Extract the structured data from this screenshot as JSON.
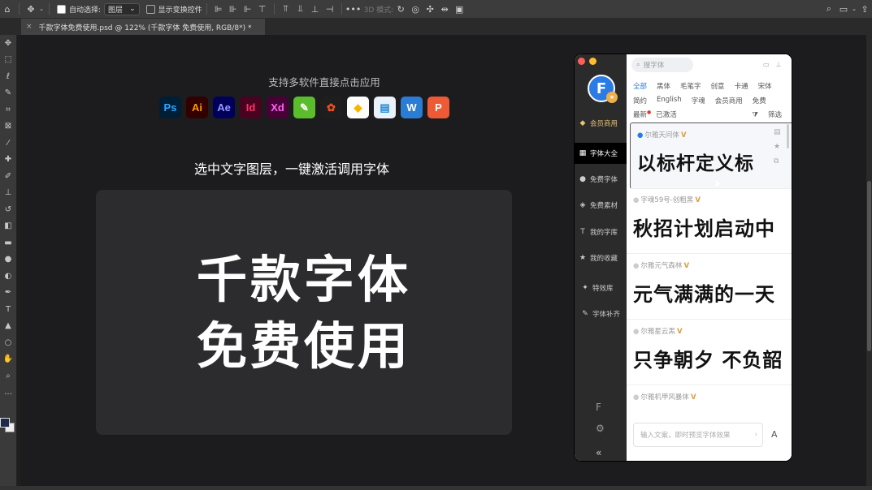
{
  "optbar": {
    "auto_select_label": "自动选择:",
    "auto_select_value": "图层",
    "show_transform_label": "显示变换控件",
    "mode_3d_label": "3D 模式:"
  },
  "tab": {
    "close": "×",
    "title": "千款字体免费使用.psd @ 122% (千款字体 免费使用, RGB/8*) *"
  },
  "canvas": {
    "subtitle": "支持多软件直接点击应用",
    "apps": [
      {
        "label": "Ps",
        "bg": "#001e36",
        "fg": "#31a8ff"
      },
      {
        "label": "Ai",
        "bg": "#330000",
        "fg": "#ff9a00"
      },
      {
        "label": "Ae",
        "bg": "#00005b",
        "fg": "#9999ff"
      },
      {
        "label": "Id",
        "bg": "#49021f",
        "fg": "#ff3366"
      },
      {
        "label": "Xd",
        "bg": "#470137",
        "fg": "#ff61f6"
      },
      {
        "label": "",
        "bg": "#5bbd2b",
        "fg": "#ffffff"
      },
      {
        "label": "",
        "bg": "#1e1e1e",
        "fg": "#f24e1e"
      },
      {
        "label": "",
        "bg": "#fdfdfd",
        "fg": "#f7b500"
      },
      {
        "label": "",
        "bg": "#e9f2fb",
        "fg": "#1f8bd6"
      },
      {
        "label": "W",
        "bg": "#2b7cd3",
        "fg": "#ffffff"
      },
      {
        "label": "P",
        "bg": "#ee5a35",
        "fg": "#ffffff"
      }
    ],
    "headline": "选中文字图层，一键激活调用字体",
    "big_line1": "千款字体",
    "big_line2": "免费使用"
  },
  "panel": {
    "nav": [
      {
        "label": "会员商用",
        "icon": "◆"
      },
      {
        "label": "字体大全",
        "icon": "▦"
      },
      {
        "label": "免费字体",
        "icon": "●"
      },
      {
        "label": "免费素材",
        "icon": "◈"
      },
      {
        "label": "我的字库",
        "icon": "T"
      },
      {
        "label": "我的收藏",
        "icon": "★"
      },
      {
        "label": "特效库",
        "icon": "✦"
      },
      {
        "label": "字体补齐",
        "icon": "✎"
      }
    ],
    "collapse": "«",
    "search_placeholder": "搜字体",
    "cats_row1": [
      "全部",
      "黑体",
      "毛笔字",
      "创意",
      "卡通",
      "宋体"
    ],
    "cats_row2": [
      "简约",
      "English",
      "字魂",
      "会员商用",
      "免费"
    ],
    "sort_latest": "最新",
    "sort_activated": "已激活",
    "filter": "筛选",
    "fonts": [
      {
        "name": "尔雅天问体",
        "preview": "以标杆定义标"
      },
      {
        "name": "字魂59号-创粗黑",
        "preview": "秋招计划启动中"
      },
      {
        "name": "尔雅元气森林",
        "preview": "元气满满的一天"
      },
      {
        "name": "尔雅星云黑",
        "preview": "只争朝夕 不负韶"
      },
      {
        "name": "尔雅机甲风暴体",
        "preview": ""
      }
    ],
    "input_placeholder": "输入文案，即时预览字体效果",
    "input_arrow": "›",
    "a_button": "A"
  }
}
